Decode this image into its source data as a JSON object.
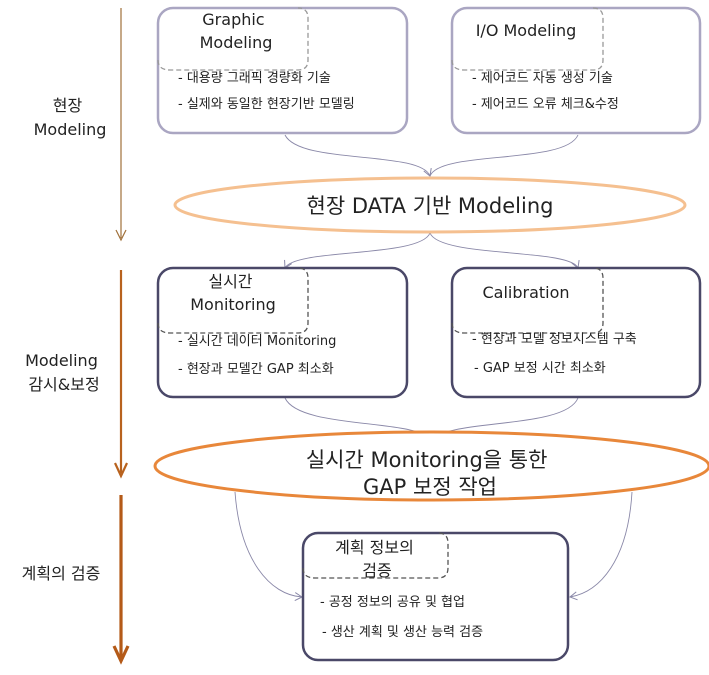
{
  "colors": {
    "stage1_arrow": "#a0703a",
    "stage2_arrow": "#b8621e",
    "stage3_arrow": "#b45a18",
    "light_box": "#aaa6c2",
    "dark_box": "#4a4868",
    "ellipse1": "#f5c090",
    "ellipse2": "#e8873a",
    "connector": "#8a88a8"
  },
  "stages": [
    {
      "lines": [
        "현장",
        "Modeling"
      ]
    },
    {
      "lines": [
        "Modeling",
        "감시&보정"
      ]
    },
    {
      "lines": [
        "계획의 검증"
      ]
    }
  ],
  "boxes": {
    "graphic": {
      "title": [
        "Graphic",
        "Modeling"
      ],
      "bullets": [
        "- 대용량 그래픽 경량화 기술",
        "- 실제와 동일한 현장기반 모델링"
      ]
    },
    "io": {
      "title": [
        "I/O Modeling"
      ],
      "bullets": [
        "- 제어코드 자동 생성 기술",
        "- 제어코드 오류 체크&수정"
      ]
    },
    "monitoring": {
      "title": [
        "실시간",
        "Monitoring"
      ],
      "bullets": [
        "- 실시간 데이터 Monitoring",
        "- 현장과 모델간 GAP 최소화"
      ]
    },
    "calibration": {
      "title": [
        "Calibration"
      ],
      "bullets": [
        "- 현장과 모델 정보시스템 구축",
        "- GAP 보정 시간 최소화"
      ]
    },
    "plan": {
      "title": [
        "계획 정보의",
        "검증"
      ],
      "bullets": [
        "- 공정 정보의 공유 및 협업",
        "- 생산 계획 및 생산 능력 검증"
      ]
    }
  },
  "ellipses": {
    "modeling": {
      "lines": [
        "현장 DATA 기반 Modeling"
      ]
    },
    "gap": {
      "lines": [
        "실시간 Monitoring을  통한",
        "GAP 보정 작업"
      ]
    }
  }
}
